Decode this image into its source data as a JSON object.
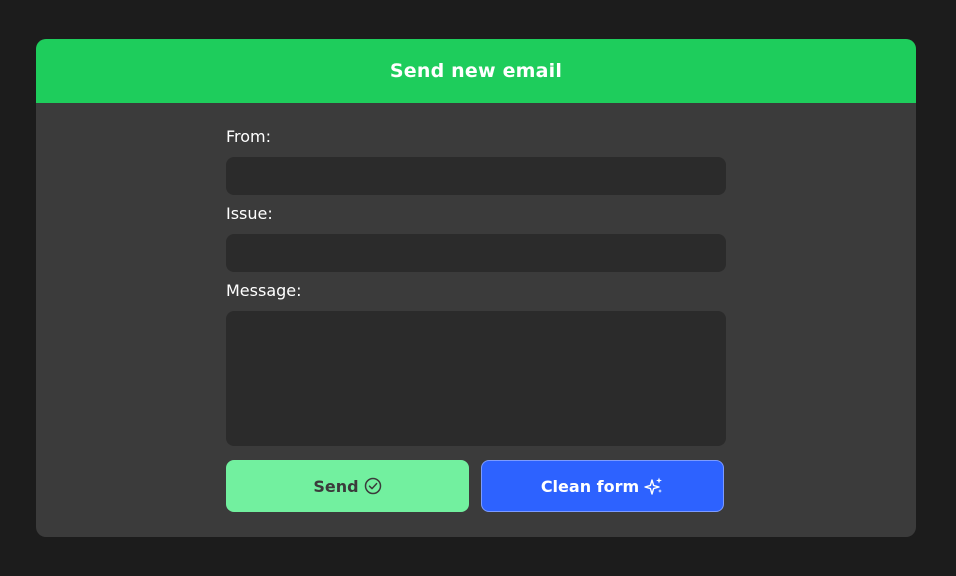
{
  "header": {
    "title": "Send new email"
  },
  "form": {
    "from_label": "From:",
    "from_value": "",
    "issue_label": "Issue:",
    "issue_value": "",
    "message_label": "Message:",
    "message_value": ""
  },
  "actions": {
    "send_label": "Send",
    "send_icon": "check-circle-icon",
    "clean_label": "Clean form",
    "clean_icon": "sparkles-icon"
  },
  "colors": {
    "page_background": "#1c1c1c",
    "card_background": "#3b3b3b",
    "header_green": "#1ecd5c",
    "input_background": "#2b2b2b",
    "send_button": "#72f09f",
    "clean_button": "#2d62ff"
  }
}
